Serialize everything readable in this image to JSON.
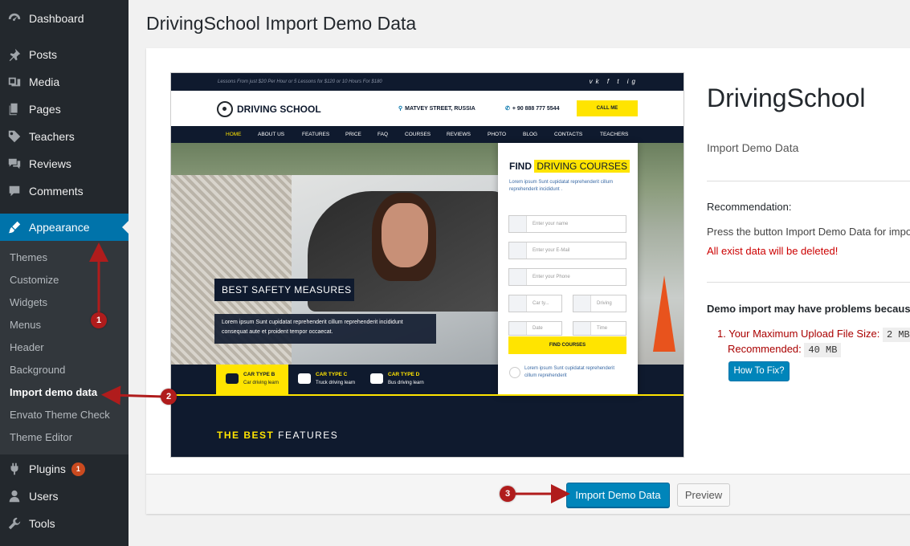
{
  "page": {
    "title": "DrivingSchool Import Demo Data"
  },
  "sidebar": {
    "items": [
      {
        "label": "Dashboard",
        "icon": "dashboard-icon"
      },
      {
        "label": "Posts",
        "icon": "pin-icon"
      },
      {
        "label": "Media",
        "icon": "media-icon"
      },
      {
        "label": "Pages",
        "icon": "pages-icon"
      },
      {
        "label": "Teachers",
        "icon": "tag-icon"
      },
      {
        "label": "Reviews",
        "icon": "comments-icon"
      },
      {
        "label": "Comments",
        "icon": "comment-icon"
      },
      {
        "label": "Appearance",
        "icon": "brush-icon"
      },
      {
        "label": "Plugins",
        "icon": "plug-icon",
        "badge": "1"
      },
      {
        "label": "Users",
        "icon": "user-icon"
      },
      {
        "label": "Tools",
        "icon": "wrench-icon"
      }
    ],
    "submenu": [
      {
        "label": "Themes"
      },
      {
        "label": "Customize"
      },
      {
        "label": "Widgets"
      },
      {
        "label": "Menus"
      },
      {
        "label": "Header"
      },
      {
        "label": "Background"
      },
      {
        "label": "Import demo data"
      },
      {
        "label": "Envato Theme Check"
      },
      {
        "label": "Theme Editor"
      }
    ]
  },
  "preview": {
    "topbar_text": "Lessons From just $20 Per Hour or 5 Lessons for $120 or 10 Hours For $180",
    "social": "vk f t ig",
    "logo": "DRIVING SCHOOL",
    "address": "MATVEY STREET, RUSSIA",
    "phone": "+ 90 888 777 5544",
    "call_button": "CALL ME",
    "nav": [
      "HOME",
      "ABOUT US",
      "FEATURES",
      "PRICE",
      "FAQ",
      "COURSES",
      "REVIEWS",
      "PHOTO",
      "BLOG",
      "CONTACTS",
      "TEACHERS"
    ],
    "hero_caption": "BEST SAFETY MEASURES",
    "hero_text": "Lorem ipsum Sunt cupidatat reprehenderit cillum reprehenderit incididunt consequat aute et proident tempor occaecat.",
    "find_title": "FIND",
    "find_highlight": "DRIVING COURSES",
    "find_desc": "Lorem ipsum Sunt cupidatat reprehenderit cillum reprehenderit incididunt .",
    "inputs": [
      "Enter your name",
      "Enter your E-Mail",
      "Enter your Phone"
    ],
    "selects": [
      "Car ty...",
      "Driving",
      "Date",
      "Time"
    ],
    "find_button": "FIND COURSES",
    "find_note": "Lorem ipsum Sunt cupidatat reprehenderit cillum reprehenderit",
    "car_types": [
      {
        "title": "CAR TYPE B",
        "sub": "Car driving learn"
      },
      {
        "title": "CAR TYPE C",
        "sub": "Truck driving learn"
      },
      {
        "title": "CAR TYPE D",
        "sub": "Bus driving learn"
      }
    ],
    "features_hl": "THE BEST",
    "features_rest": " FEATURES"
  },
  "info": {
    "theme_name": "DrivingSchool",
    "subtitle": "Import Demo Data",
    "recommendation_title": "Recommendation:",
    "recommendation_text": "Press the button Import Demo Data for impo",
    "warning": "All exist data will be deleted!",
    "problems_title": "Demo import may have problems because:",
    "problem_label": "1. Your Maximum Upload File Size:",
    "problem_value": "2 MB",
    "recommended_label": "Recommended:",
    "recommended_value": "40 MB",
    "fix_button": "How To Fix?"
  },
  "actions": {
    "import_button": "Import Demo Data",
    "preview_button": "Preview"
  },
  "annotations": [
    "1",
    "2",
    "3"
  ],
  "colors": {
    "sidebar": "#23282d",
    "accent": "#0073aa",
    "annotation": "#b01c1c",
    "highlight": "#ffe400"
  }
}
